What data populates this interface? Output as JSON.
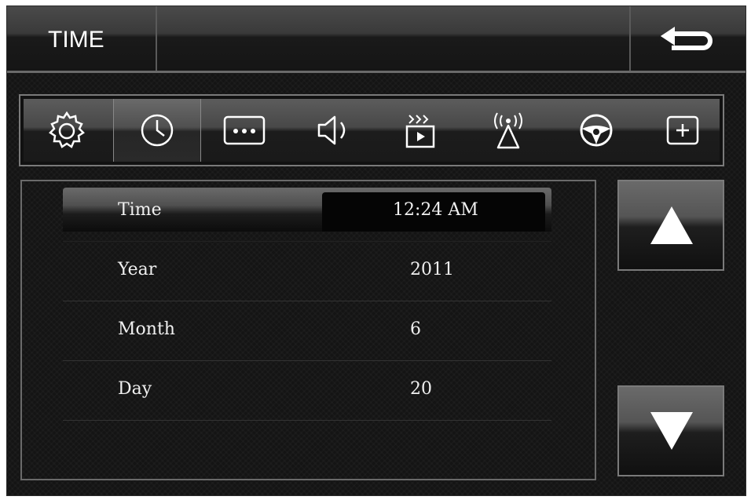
{
  "header": {
    "title": "TIME"
  },
  "tabs": [
    {
      "icon": "gear-icon",
      "active": false
    },
    {
      "icon": "clock-icon",
      "active": true
    },
    {
      "icon": "dots-icon",
      "active": false
    },
    {
      "icon": "speaker-icon",
      "active": false
    },
    {
      "icon": "video-icon",
      "active": false
    },
    {
      "icon": "antenna-icon",
      "active": false
    },
    {
      "icon": "steering-wheel-icon",
      "active": false
    },
    {
      "icon": "plus-icon",
      "active": false
    }
  ],
  "rows": [
    {
      "label": "Time",
      "value": "12:24 AM"
    },
    {
      "label": "Year",
      "value": "2011"
    },
    {
      "label": "Month",
      "value": "6"
    },
    {
      "label": "Day",
      "value": "20"
    }
  ],
  "colors": {
    "background": "#141414",
    "text": "#f0f0f0",
    "border": "#7a7a7a"
  }
}
